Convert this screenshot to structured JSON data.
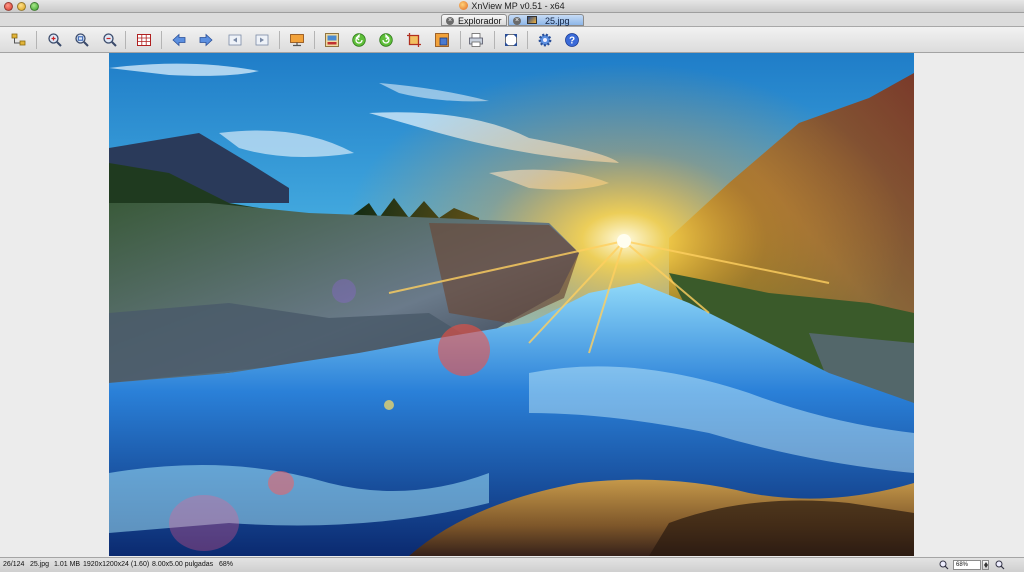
{
  "window": {
    "title": "XnView MP v0.51 - x64"
  },
  "tabs": [
    {
      "label": "Explorador",
      "close_glyph": "×"
    },
    {
      "label": "25.jpg",
      "close_glyph": "×"
    }
  ],
  "toolbar": {
    "buttons": [
      {
        "icon": "browser-tree-icon"
      },
      {
        "icon": "zoom-in-icon"
      },
      {
        "icon": "zoom-fit-icon"
      },
      {
        "icon": "zoom-out-icon"
      },
      {
        "icon": "grid-view-icon"
      },
      {
        "icon": "previous-arrow-icon"
      },
      {
        "icon": "next-arrow-icon"
      },
      {
        "icon": "first-page-icon"
      },
      {
        "icon": "last-page-icon"
      },
      {
        "icon": "slideshow-icon"
      },
      {
        "icon": "properties-icon"
      },
      {
        "icon": "rotate-left-icon"
      },
      {
        "icon": "rotate-right-icon"
      },
      {
        "icon": "crop-icon"
      },
      {
        "icon": "resize-icon"
      },
      {
        "icon": "print-icon"
      },
      {
        "icon": "fullscreen-icon"
      },
      {
        "icon": "settings-gear-icon"
      },
      {
        "icon": "help-icon"
      }
    ]
  },
  "status": {
    "position": "26/124",
    "filename": "25.jpg",
    "filesize": "1.01 MB",
    "dimensions": "1920x1200x24 (1.60)",
    "print_size": "8.00x5.00 pulgadas",
    "zoom_percent": "68%",
    "zoom_field": "68%"
  }
}
